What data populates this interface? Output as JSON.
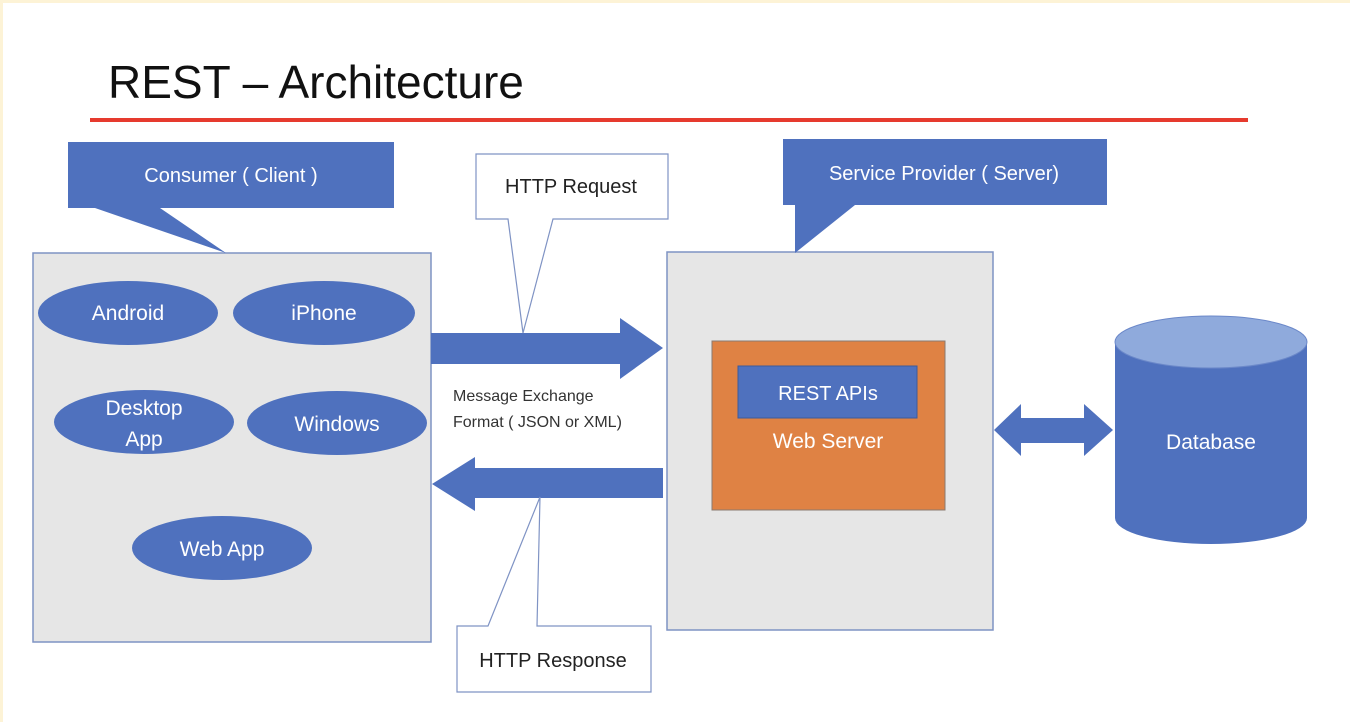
{
  "title": "REST – Architecture",
  "colors": {
    "blue": "#4f71be",
    "light_blue": "#8faadc",
    "orange": "#df8244",
    "gray": "#e6e6e6",
    "red": "#e63a2e"
  },
  "client": {
    "callout": "Consumer ( Client )",
    "apps": [
      "Android",
      "iPhone",
      "Desktop",
      "App",
      "Windows",
      "Web App"
    ]
  },
  "server": {
    "callout": "Service Provider ( Server)",
    "rest_apis": "REST APIs",
    "web_server": "Web Server"
  },
  "database": "Database",
  "request_label": "HTTP Request",
  "response_label": "HTTP Response",
  "message_format": [
    "Message Exchange",
    "Format ( JSON or XML)"
  ]
}
